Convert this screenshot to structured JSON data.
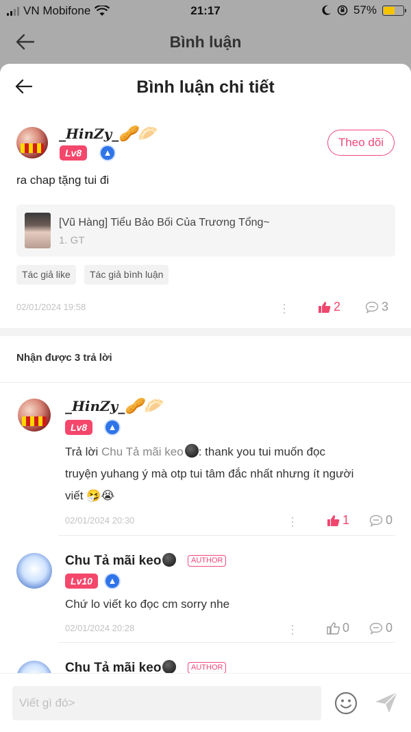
{
  "status_bar": {
    "carrier": "VN Mobifone",
    "time": "21:17",
    "battery": "57%",
    "battery_level": 0.57
  },
  "background_header": {
    "title": "Bình luận"
  },
  "sheet": {
    "title": "Bình luận chi tiết"
  },
  "main_comment": {
    "username": "_HinZy_",
    "username_emojis": "🥜🥟",
    "level": "Lv8",
    "follow_label": "Theo dõi",
    "text": "ra chap tặng tui đi",
    "book": {
      "title": "[Vũ Hàng] Tiểu Bảo Bối Của Trương Tổng~",
      "chapter": "1. GT"
    },
    "tags": [
      "Tác giả like",
      "Tác giả bình luận"
    ],
    "date": "02/01/2024 19:58",
    "likes": "2",
    "comments": "3"
  },
  "replies_header": "Nhận được 3 trả lời",
  "replies": [
    {
      "username": "_HinZy_",
      "username_emojis": "🥜🥟",
      "level": "Lv8",
      "reply_prefix": "Trả lời ",
      "mention": "Chu Tả mãi keo",
      "text_line1": ": thank you tui muốn đọc",
      "text_line2": "truyện yuhang ý mà otp tui tâm đắc nhất nhưng ít người",
      "text_line3": "viết 🤧😭",
      "date": "02/01/2024 20:30",
      "likes": "1",
      "comments": "0"
    },
    {
      "username": "Chu Tả mãi keo",
      "author_badge": "AUTHOR",
      "level": "Lv10",
      "text": "Chứ lo viết ko đọc cm sorry nhe",
      "date": "02/01/2024 20:28",
      "likes": "0",
      "comments": "0"
    },
    {
      "username": "Chu Tả mãi keo",
      "author_badge": "AUTHOR"
    }
  ],
  "input": {
    "placeholder": "Viết gì đó>"
  },
  "colors": {
    "accent": "#f0487a",
    "level_badge": "#f4476b",
    "like_active": "#f0476e"
  }
}
